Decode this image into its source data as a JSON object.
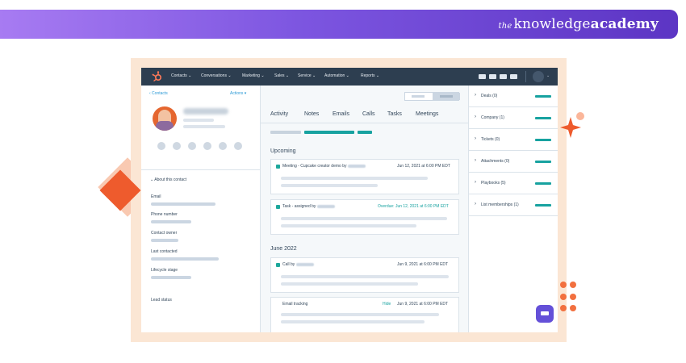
{
  "brand": {
    "prefix": "the",
    "name": "knowledge",
    "suffix": "academy"
  },
  "colors": {
    "banner_start": "#a77bf2",
    "banner_end": "#5c35c4",
    "nav_bg": "#2d3e50",
    "accent_teal": "#17a2a0",
    "orange": "#ee5b2d"
  },
  "topnav": {
    "items": [
      "Contacts ⌄",
      "Conversations ⌄",
      "Marketing ⌄",
      "Sales ⌄",
      "Service ⌄",
      "Automation ⌄",
      "Reports ⌄"
    ],
    "caret": "⌄"
  },
  "left": {
    "back_label": "‹ Contacts",
    "actions_label": "Actions ▾",
    "about_label": "⌄  About this contact",
    "fields": [
      "Email",
      "Phone number",
      "Contact owner",
      "Last contacted",
      "Lifecycle stage",
      "Lead status"
    ]
  },
  "middle": {
    "tabs": [
      "Activity",
      "Notes",
      "Emails",
      "Calls",
      "Tasks",
      "Meetings"
    ],
    "upcoming_title": "Upcoming",
    "june_title": "June 2022",
    "cards": [
      {
        "title": "Meeting - Cupcake creator demo by",
        "date": "Jun 12, 2021 at 6:00 PM EDT"
      },
      {
        "title": "Task - assigned by",
        "date": "Overdue: Jun 12, 2021 at 6:00 PM EDT"
      },
      {
        "title": "Call by",
        "date": "Jun 9, 2021 at 6:00 PM EDT"
      },
      {
        "title": "Email tracking",
        "hide": "Hide",
        "date": "Jun 9, 2021 at 6:00 PM EDT"
      }
    ]
  },
  "right": {
    "sections": [
      "Deals (0)",
      "Company (1)",
      "Tickets (0)",
      "Attachments (0)",
      "Playbooks (5)",
      "List memberships (1)"
    ]
  }
}
